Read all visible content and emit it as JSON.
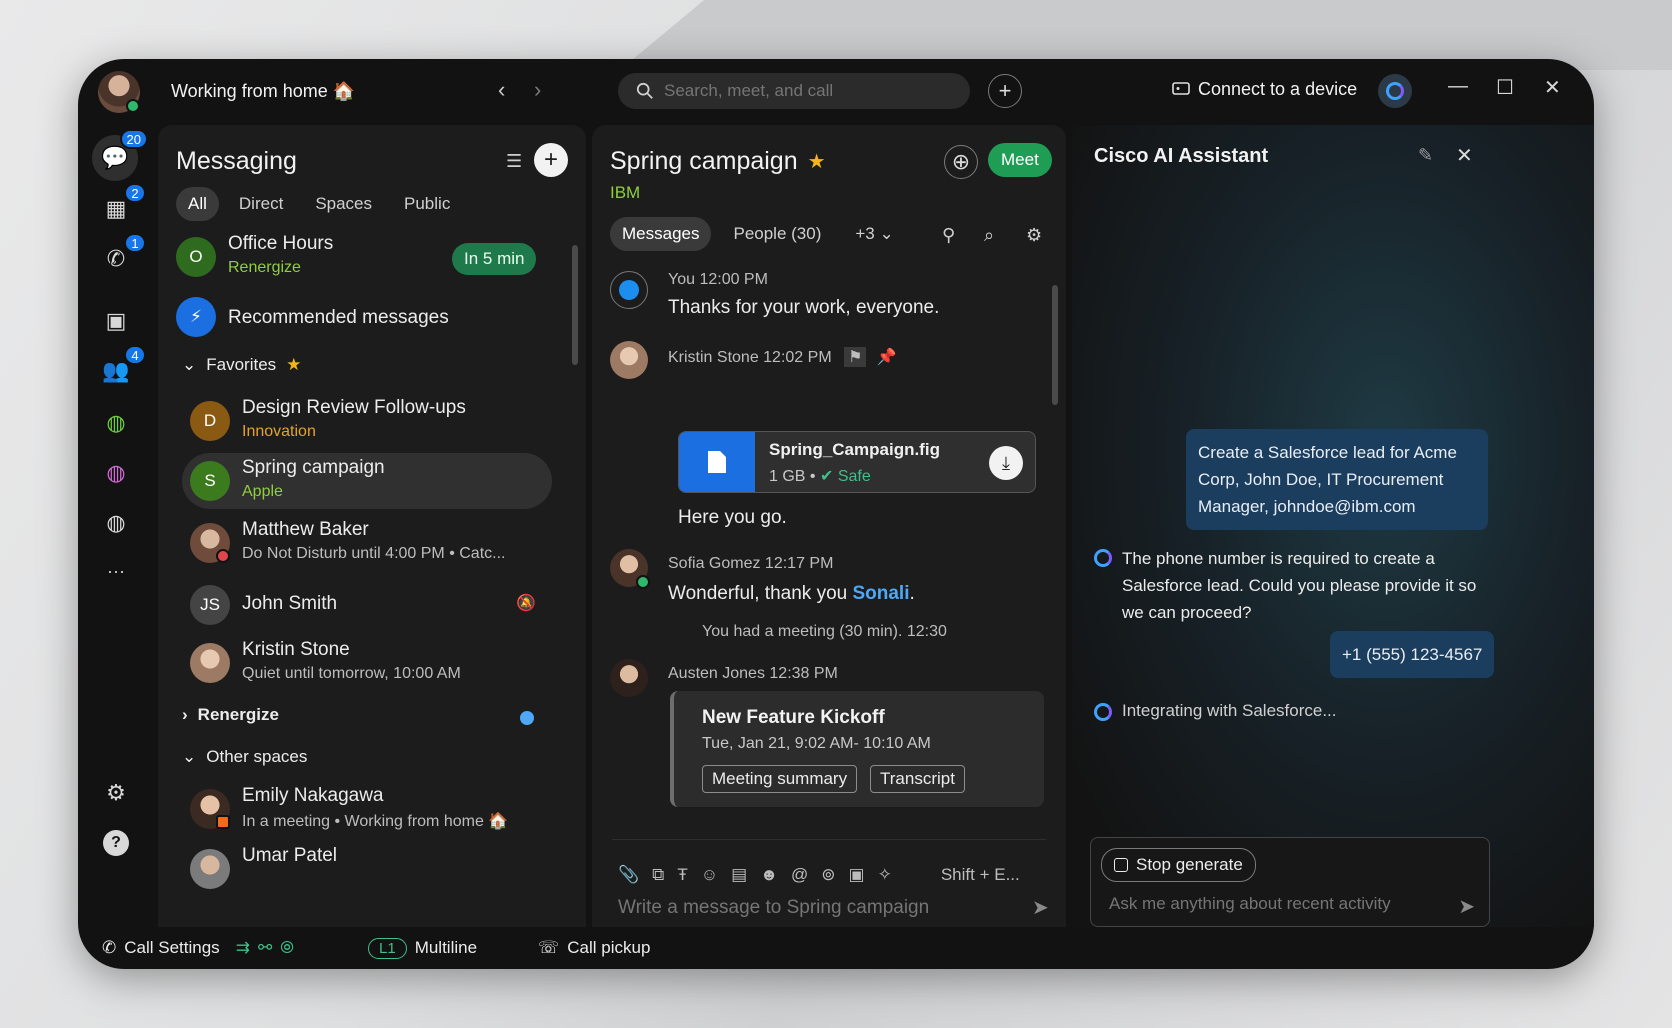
{
  "header": {
    "status": "Working from home 🏠",
    "search_placeholder": "Search, meet, and call",
    "connect_label": "Connect to a device"
  },
  "rail": {
    "badges": {
      "messaging": "20",
      "calendar": "2",
      "calls": "1",
      "teams": "4"
    },
    "more": "···"
  },
  "messaging": {
    "title": "Messaging",
    "tabs": [
      "All",
      "Direct",
      "Spaces",
      "Public"
    ],
    "office_hours": {
      "initial": "O",
      "title": "Office Hours",
      "sub": "Renergize",
      "pill": "In 5 min"
    },
    "recommended": "Recommended messages",
    "favorites_label": "Favorites",
    "favorites": [
      {
        "initial": "D",
        "title": "Design Review Follow-ups",
        "sub": "Innovation"
      },
      {
        "initial": "S",
        "title": "Spring campaign",
        "sub": "Apple"
      }
    ],
    "people": [
      {
        "title": "Matthew Baker",
        "sub": "Do Not Disturb until 4:00 PM  •  Catc..."
      },
      {
        "initial": "JS",
        "title": "John Smith"
      },
      {
        "title": "Kristin Stone",
        "sub": "Quiet until tomorrow, 10:00 AM"
      }
    ],
    "renergize_label": "Renergize",
    "other_label": "Other spaces",
    "other": [
      {
        "title": "Emily Nakagawa",
        "sub": "In a meeting  •  Working from home 🏠"
      },
      {
        "title": "Umar Patel"
      }
    ]
  },
  "chat": {
    "title": "Spring campaign",
    "org": "IBM",
    "meet": "Meet",
    "tabs": [
      "Messages",
      "People (30)",
      "+3"
    ],
    "messages": {
      "m1_meta": "You  12:00 PM",
      "m1_text": "Thanks for your work, everyone.",
      "m2_meta": "Kristin Stone  12:02 PM",
      "file_name": "Spring_Campaign.fig",
      "file_size": "1 GB",
      "file_safe": "Safe",
      "m2_text": "Here you go.",
      "m3_meta": "Sofia Gomez  12:17 PM",
      "m3_text": "Wonderful, thank you",
      "m3_mention": "Sonali",
      "meeting_note": "You had a meeting (30 min). 12:30",
      "m4_meta": "Austen Jones  12:38 PM",
      "card_title": "New Feature Kickoff",
      "card_time": "Tue, Jan 21, 9:02 AM- 10:10 AM",
      "card_btn1": "Meeting summary",
      "card_btn2": "Transcript"
    },
    "shortcut": "Shift + E...",
    "composer_placeholder": "Write a message to Spring campaign"
  },
  "ai": {
    "title": "Cisco AI Assistant",
    "user_msg1": "Create a Salesforce lead for Acme Corp, John Doe, IT Procurement Manager, johndoe@ibm.com",
    "reply1": "The phone number is required to create a Salesforce lead. Could you please provide it so we can proceed?",
    "user_msg2": "+1 (555) 123-4567",
    "status": "Integrating with Salesforce...",
    "stop": "Stop generate",
    "input_placeholder": "Ask me anything about recent activity"
  },
  "footer": {
    "call_settings": "Call Settings",
    "line": "L1",
    "multiline": "Multiline",
    "pickup": "Call pickup"
  },
  "colors": {
    "accent_green": "#1f9d55",
    "sub_green": "#8fcf3e",
    "badge_blue": "#1877e8",
    "file_blue": "#1b6fe0"
  }
}
